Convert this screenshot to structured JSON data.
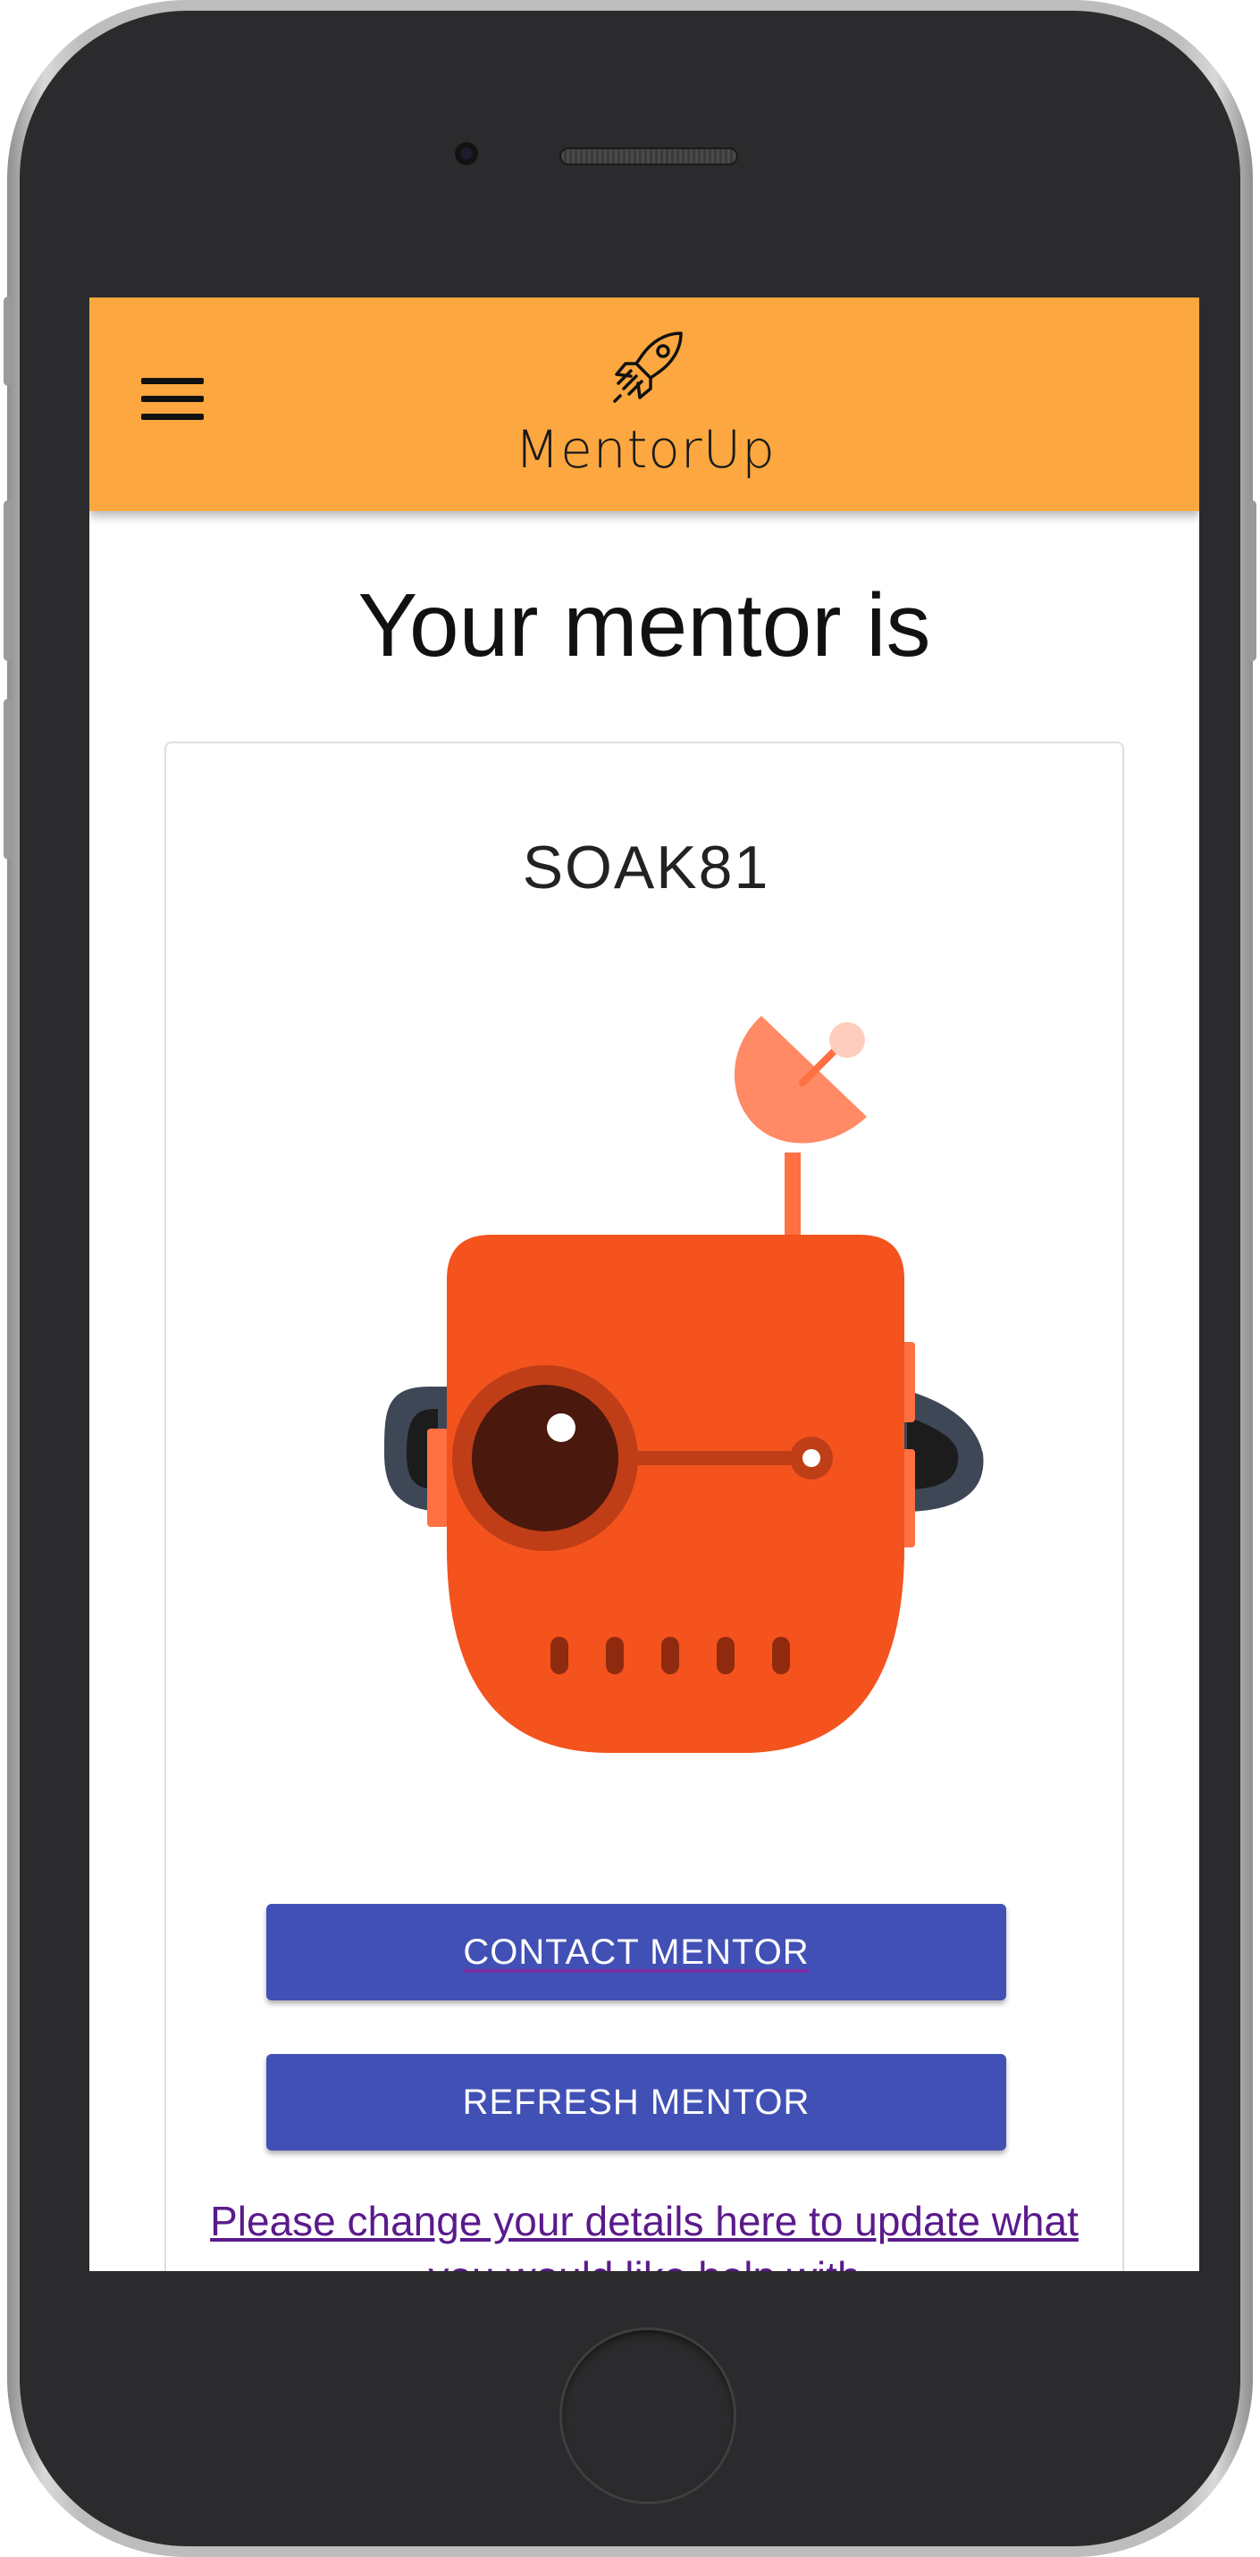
{
  "app": {
    "brand_name": "MentorUp"
  },
  "page": {
    "title": "Your mentor is"
  },
  "mentor": {
    "name": "SOAK81"
  },
  "actions": {
    "contact_label": "CONTACT MENTOR",
    "refresh_label": "REFRESH MENTOR"
  },
  "details_link": {
    "text": "Please change your details here to update what you would like help with"
  },
  "colors": {
    "appbar": "#fca73f",
    "button": "#4150b5",
    "robot_head": "#f4531e",
    "robot_antenna_dish": "#ff8a65",
    "link": "#5a1a8b"
  },
  "icons": {
    "menu": "hamburger-menu-icon",
    "logo": "rocket-icon"
  }
}
